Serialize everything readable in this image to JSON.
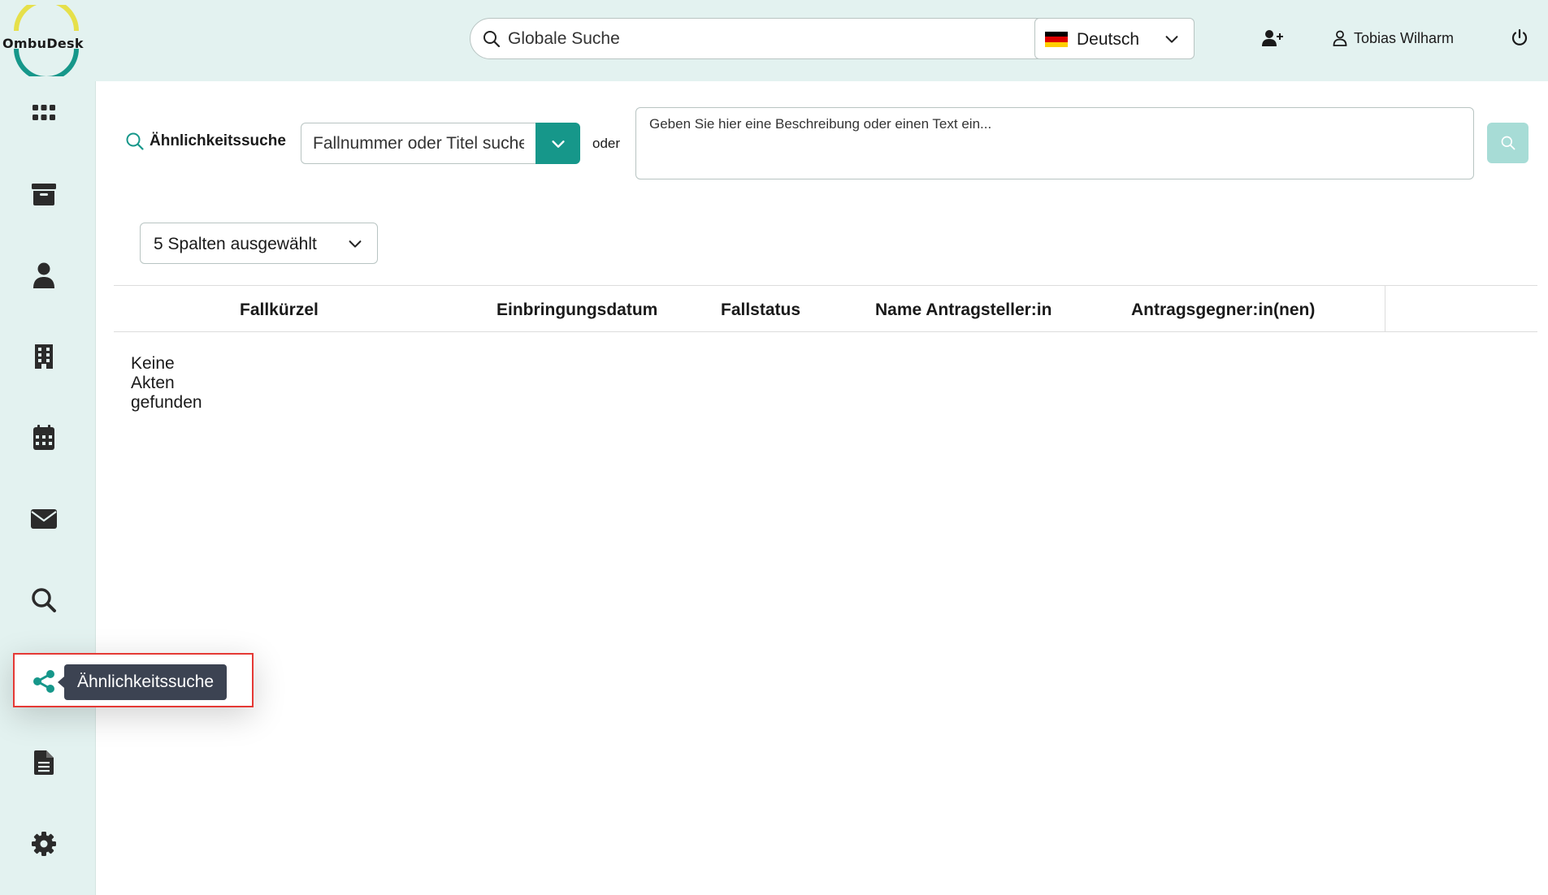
{
  "app": {
    "logo_text": "OmbuDesk"
  },
  "header": {
    "search_placeholder": "Globale Suche",
    "language": "Deutsch",
    "user_name": "Tobias Wilharm"
  },
  "sidebar": {
    "items": [
      {
        "name": "apps",
        "icon": "grid-icon"
      },
      {
        "name": "archive",
        "icon": "archive-icon"
      },
      {
        "name": "persons",
        "icon": "user-icon"
      },
      {
        "name": "organizations",
        "icon": "building-icon"
      },
      {
        "name": "calendar",
        "icon": "calendar-icon"
      },
      {
        "name": "mail",
        "icon": "envelope-icon"
      },
      {
        "name": "search",
        "icon": "search-icon"
      },
      {
        "name": "similarity-search",
        "icon": "share-icon"
      },
      {
        "name": "documents",
        "icon": "file-icon"
      },
      {
        "name": "settings",
        "icon": "gear-icon"
      }
    ],
    "tooltip": "Ähnlichkeitssuche"
  },
  "similarity": {
    "label": "Ähnlichkeitssuche",
    "case_placeholder": "Fallnummer oder Titel suchen",
    "or_label": "oder",
    "description_placeholder": "Geben Sie hier eine Beschreibung oder einen Text ein..."
  },
  "columns_select": {
    "value": "5 Spalten ausgewählt"
  },
  "table": {
    "headers": [
      "Fallkürzel",
      "Einbringungsdatum",
      "Fallstatus",
      "Name Antragsteller:in",
      "Antragsgegner:in(nen)"
    ],
    "empty_message": "Keine Akten gefunden"
  },
  "colors": {
    "accent": "#16978a",
    "header_bg": "#e3f2f0",
    "tooltip_bg": "#3c4352",
    "highlight": "#e53935"
  }
}
